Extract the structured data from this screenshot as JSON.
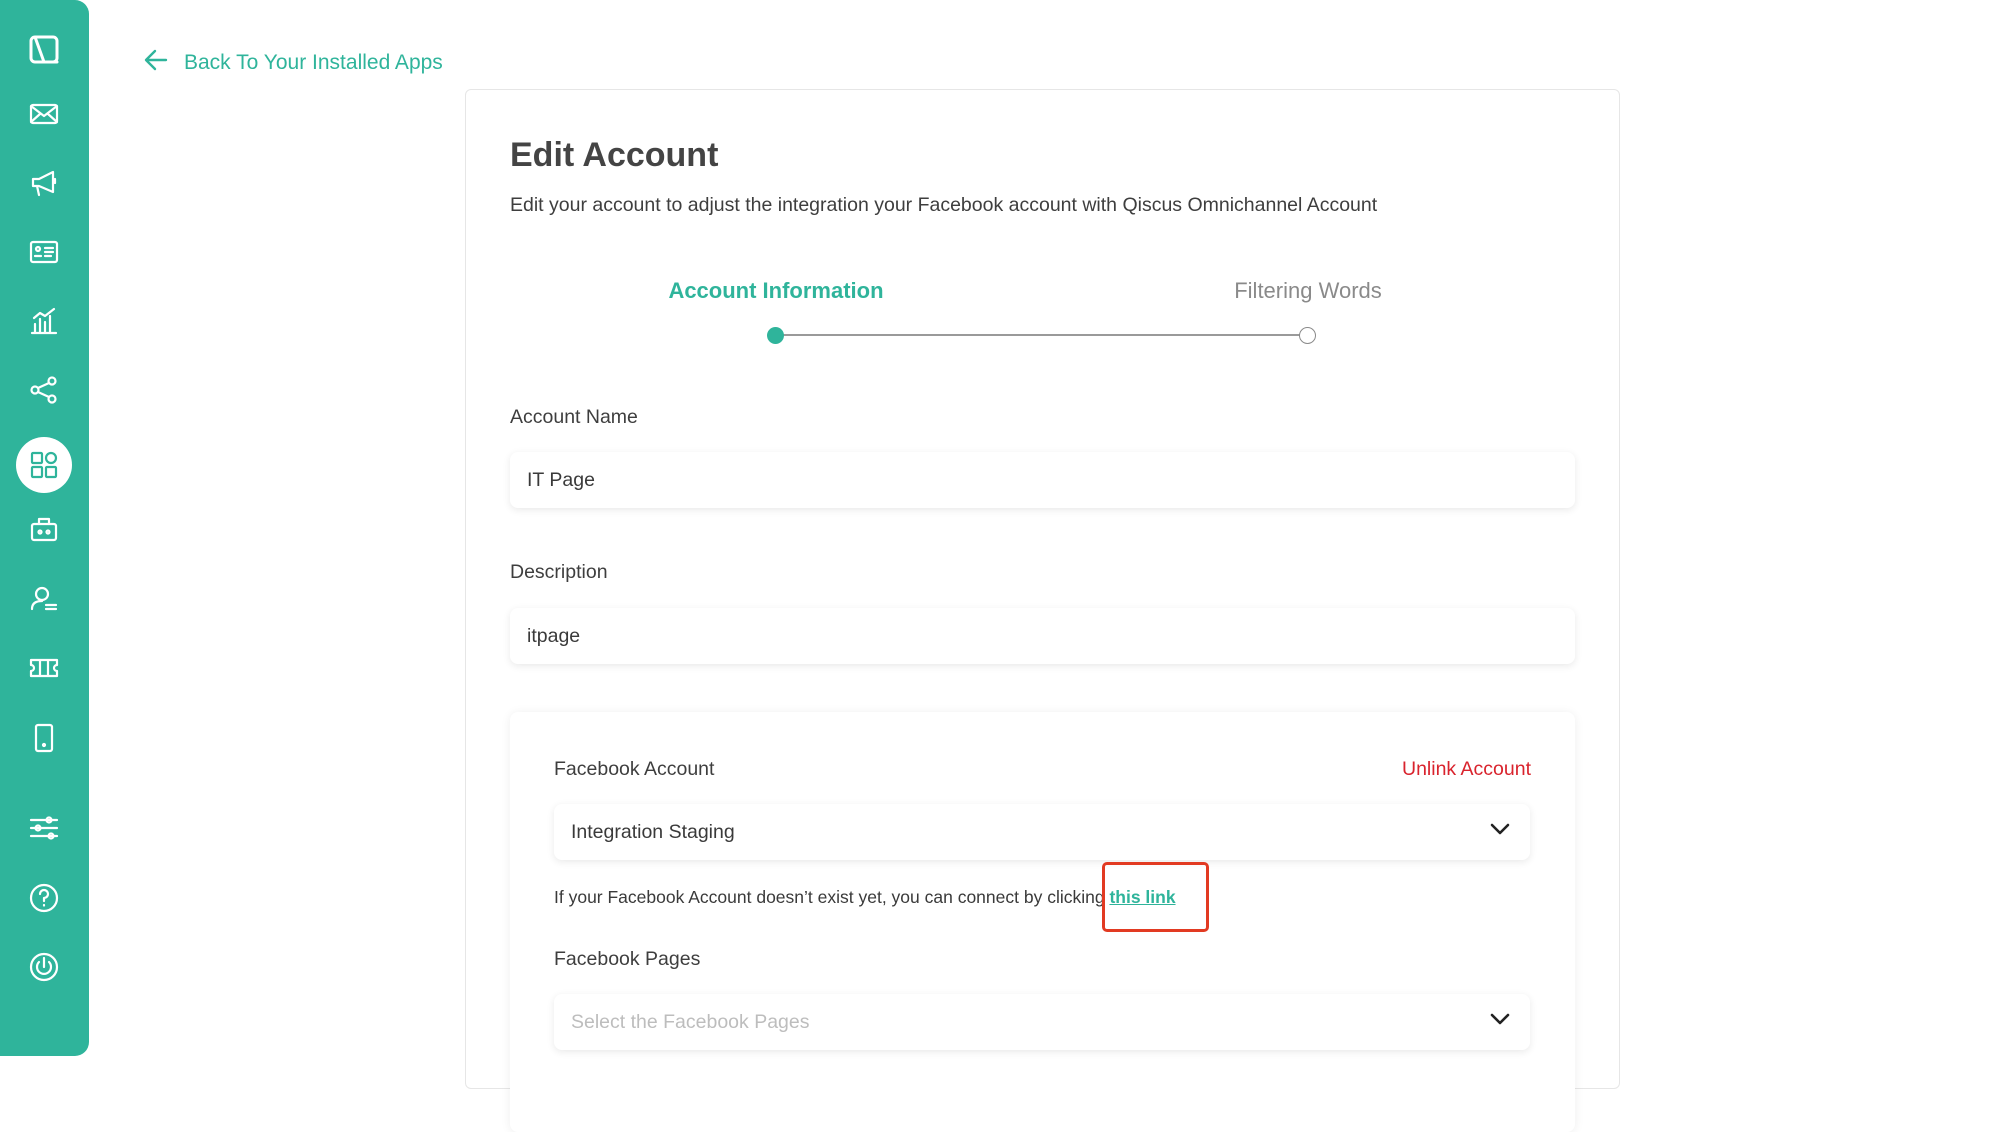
{
  "sidebar": {
    "items": [
      {
        "icon": "qiscus-logo-icon"
      },
      {
        "icon": "mail-icon"
      },
      {
        "icon": "megaphone-icon"
      },
      {
        "icon": "contact-card-icon"
      },
      {
        "icon": "analytics-icon"
      },
      {
        "icon": "share-nodes-icon"
      },
      {
        "icon": "apps-grid-icon",
        "active": true
      },
      {
        "icon": "robot-icon"
      },
      {
        "icon": "agent-icon"
      },
      {
        "icon": "ticket-icon"
      },
      {
        "icon": "mobile-icon"
      },
      {
        "icon": "settings-sliders-icon"
      },
      {
        "icon": "help-icon"
      },
      {
        "icon": "power-icon"
      }
    ]
  },
  "back_link": {
    "label": "Back To Your Installed Apps",
    "icon": "arrow-left-icon"
  },
  "page": {
    "title": "Edit Account",
    "subtitle": "Edit your account to adjust the integration your Facebook account with Qiscus Omnichannel Account"
  },
  "stepper": {
    "steps": [
      {
        "label": "Account Information",
        "active": true
      },
      {
        "label": "Filtering Words",
        "active": false
      }
    ]
  },
  "form": {
    "account_name": {
      "label": "Account Name",
      "value": "IT Page"
    },
    "description": {
      "label": "Description",
      "value": "itpage"
    },
    "facebook": {
      "account_label": "Facebook Account",
      "unlink_label": "Unlink Account",
      "account_value": "Integration Staging",
      "hint_text": "If your Facebook Account doesn’t exist yet, you can connect by clicking ",
      "hint_link": "this link",
      "pages_label": "Facebook Pages",
      "pages_placeholder": "Select the Facebook Pages"
    }
  },
  "colors": {
    "accent": "#2fb49b",
    "danger": "#d9232d",
    "highlight": "#e23a22"
  }
}
